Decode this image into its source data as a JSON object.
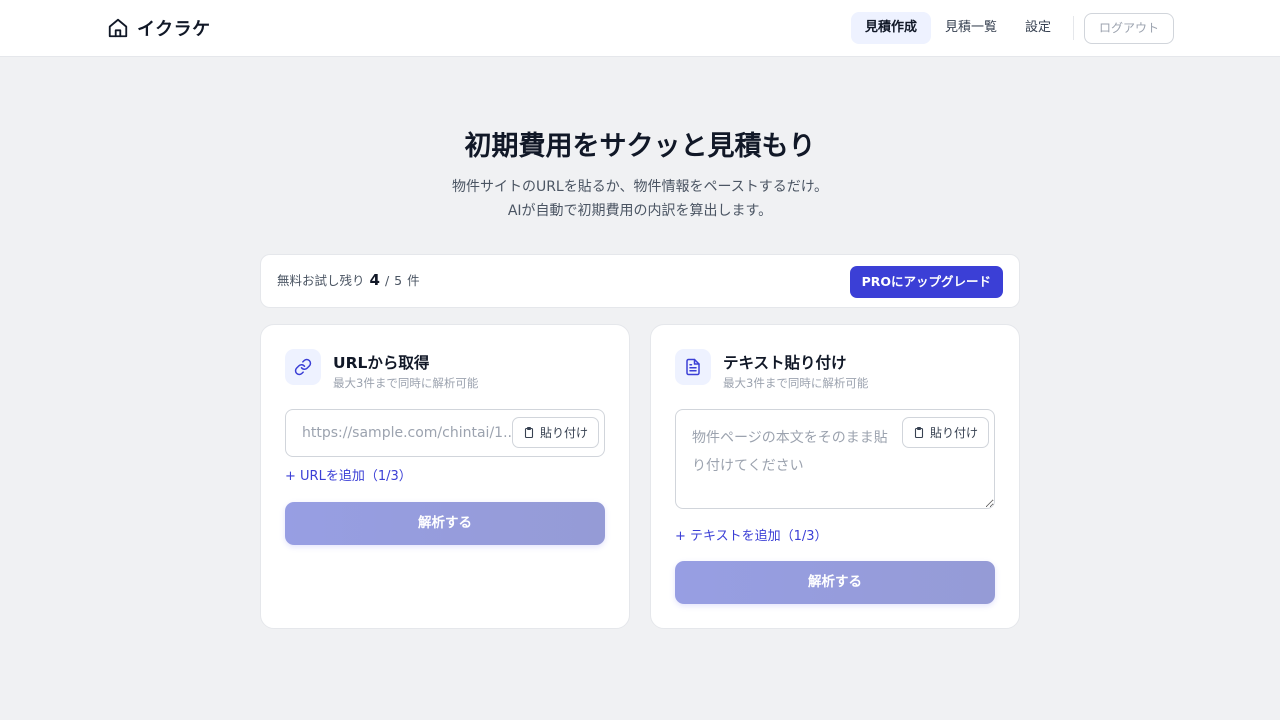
{
  "app": {
    "name": "イクラケ"
  },
  "nav": {
    "items": [
      {
        "label": "見積作成",
        "active": true
      },
      {
        "label": "見積一覧",
        "active": false
      },
      {
        "label": "設定",
        "active": false
      }
    ],
    "logout_label": "ログアウト"
  },
  "hero": {
    "title": "初期費用をサクッと見積もり",
    "subtitle_line1": "物件サイトのURLを貼るか、物件情報をペーストするだけ。",
    "subtitle_line2": "AIが自動で初期費用の内訳を算出します。"
  },
  "trial": {
    "prefix": "無料お試し残り",
    "remaining": "4",
    "separator": "/",
    "total": "5",
    "suffix": "件",
    "upgrade_label": "PROにアップグレード"
  },
  "url_card": {
    "icon": "link-icon",
    "title": "URLから取得",
    "description": "最大3件まで同時に解析可能",
    "input_placeholder": "https://sample.com/chintai/1...",
    "paste_label": "貼り付け",
    "add_label": "+ URLを追加（1/3）",
    "analyze_label": "解析する"
  },
  "text_card": {
    "icon": "document-icon",
    "title": "テキスト貼り付け",
    "description": "最大3件まで同時に解析可能",
    "input_placeholder": "物件ページの本文をそのまま貼り付けてください",
    "paste_label": "貼り付け",
    "add_label": "+ テキストを追加（1/3）",
    "analyze_label": "解析する"
  },
  "colors": {
    "primary": "#3b3fd6",
    "button_disabled": "#979ee3",
    "background": "#f0f1f3"
  }
}
